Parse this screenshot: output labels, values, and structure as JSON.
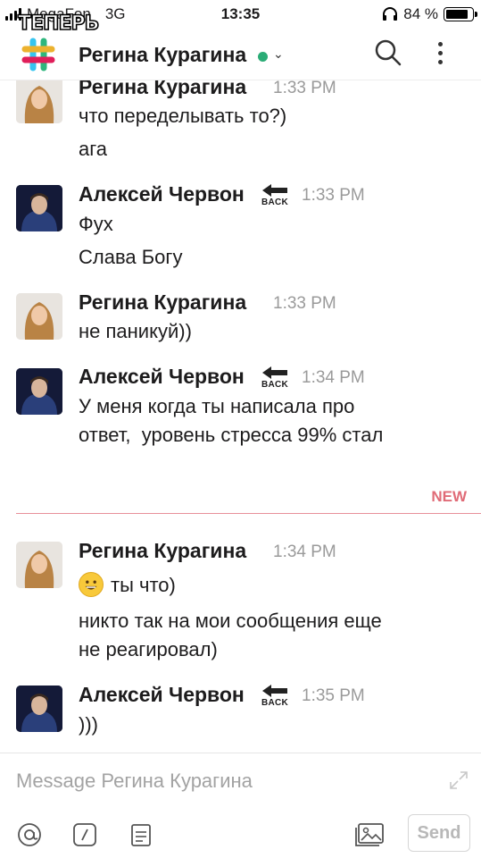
{
  "status_bar": {
    "carrier": "MegaFon",
    "network": "3G",
    "time": "13:35",
    "battery": "84 %",
    "battery_level": 0.84
  },
  "watermark": "ТЕПЕРЬ",
  "header": {
    "title": "Регина Курагина",
    "presence_color": "#2bac76",
    "search_icon": "search-icon",
    "more_icon": "more-vertical-icon"
  },
  "users": {
    "regina": "Регина Курагина",
    "aleksey": "Алексей Червон"
  },
  "badge": {
    "back_text": "BACK"
  },
  "messages": [
    {
      "author": "Регина Курагина",
      "time": "1:33 PM",
      "lines": [
        "что переделывать то?)",
        "ага"
      ]
    },
    {
      "author": "Алексей Червон",
      "time": "1:33 PM",
      "lines": [
        "Фух",
        "Слава Богу"
      ]
    },
    {
      "author": "Регина Курагина",
      "time": "1:33 PM",
      "lines": [
        "не паникуй))"
      ]
    },
    {
      "author": "Алексей Червон",
      "time": "1:34 PM",
      "lines": [
        "У меня когда ты написала про",
        "ответ,  уровень стресса 99% стал"
      ]
    },
    {
      "author": "Регина Курагина",
      "time": "1:34 PM",
      "lines": [
        "ты что)",
        "никто так на мои сообщения еще",
        "не реагировал)"
      ]
    },
    {
      "author": "Алексей Червон",
      "time": "1:35 PM",
      "lines": [
        ")))"
      ]
    }
  ],
  "new_label": "NEW",
  "new_color": "#e06b77",
  "composer": {
    "placeholder": "Message Регина Курагина",
    "send_label": "Send",
    "icons": [
      "at-icon",
      "slash-command-icon",
      "clipboard-icon",
      "image-gallery-icon",
      "expand-icon"
    ]
  }
}
